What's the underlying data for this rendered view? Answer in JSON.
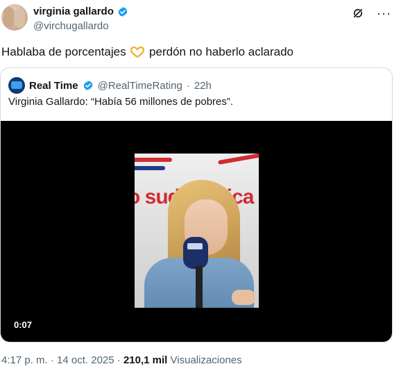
{
  "author": {
    "display_name": "virginia gallardo",
    "handle": "@virchugallardo"
  },
  "post": {
    "text_before": "Hablaba de porcentajes",
    "text_after": "perdón no haberlo aclarado"
  },
  "quoted": {
    "name": "Real Time",
    "handle": "@RealTimeRating",
    "separator": "·",
    "age": "22h",
    "text": "Virginia Gallardo: “Había 56 millones de pobres”.",
    "video_time": "0:07",
    "video_overlay_text": "o sudamerica"
  },
  "footer": {
    "time": "4:17 p. m.",
    "dot": "·",
    "date": "14 oct. 2025",
    "views_count": "210,1 mil",
    "views_label": "Visualizaciones"
  },
  "colors": {
    "verified": "#1d9bf0",
    "heart": "#f4b63a",
    "brand_red": "#d12c33"
  }
}
